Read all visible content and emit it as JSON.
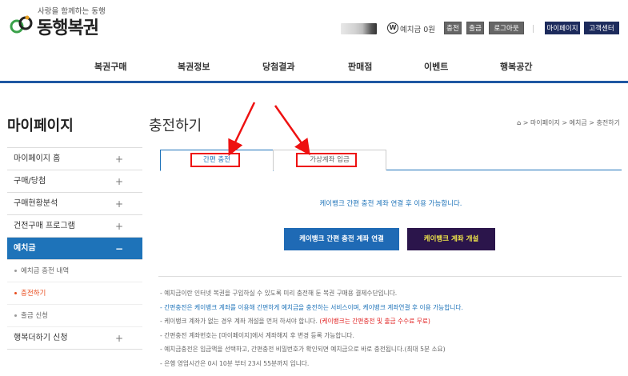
{
  "logo": {
    "tagline": "사랑을 함께하는 동행",
    "name": "동행복권"
  },
  "top_bar": {
    "deposit_icon": "W",
    "deposit_label": "예치금 0원",
    "charge_label": "충전",
    "withdraw_label": "출금",
    "logout_label": "로그아웃",
    "mypage_label": "마이페이지",
    "support_label": "고객센터"
  },
  "gnb": {
    "items": [
      "복권구매",
      "복권정보",
      "당첨결과",
      "판매점",
      "이벤트",
      "행복공간"
    ]
  },
  "sidebar": {
    "title": "마이페이지",
    "items": [
      {
        "label": "마이페이지 홈",
        "toggle": "+"
      },
      {
        "label": "구매/당첨",
        "toggle": "+"
      },
      {
        "label": "구매현황분석",
        "toggle": "+"
      },
      {
        "label": "건전구매 프로그램",
        "toggle": "+"
      },
      {
        "label": "예치금",
        "toggle": "−"
      },
      {
        "label": "행복더하기 신청",
        "toggle": "+"
      }
    ],
    "sub_items": [
      {
        "label": "예치금 충전 내역"
      },
      {
        "label": "충전하기"
      },
      {
        "label": "출금 신청"
      }
    ]
  },
  "content": {
    "title": "충전하기",
    "breadcrumb": [
      "마이페이지",
      "예치금",
      "충전하기"
    ],
    "breadcrumb_sep": ">",
    "tabs": [
      {
        "label": "간편 충전"
      },
      {
        "label": "가상계좌 입금"
      }
    ],
    "notice": "케이뱅크 간편 충전 계좌 연결 후 이용 가능합니다.",
    "buttons": {
      "link_label": "케이뱅크 간편 충전 계좌 연결",
      "open_label": "케이뱅크 계좌 개설"
    },
    "notes": [
      {
        "text": "- 예치금이란 인터넷 복권을 구입하실 수 있도록 미리 충전해 둔 복권 구매용 결제수단입니다."
      },
      {
        "text": "- 간편충전은 케이뱅크 계좌를 이용해 간편하게 예치금을 충전하는 서비스이며, 케이뱅크 계좌연결 후 이용 가능합니다."
      },
      {
        "text": "- 케이뱅크 계좌가 없는 경우 계좌 개설을 먼저 하셔야 합니다. ",
        "highlight": "(케이뱅크는 간편충전 및 출금 수수료 무료)"
      },
      {
        "text": "- 간편충전 계좌번호는 [마이페이지]에서 계좌해지 후 변경 등록 가능합니다."
      },
      {
        "text": "- 예치금충전은 입금액을 선택하고, 간편충전 비밀번호가 확인되면 예치금으로 바로 충전됩니다.(최대 5분 소요)"
      },
      {
        "text": "- 은행 영업시간은 0시 10분 부터 23시 55분까지 입니다."
      }
    ]
  },
  "colors": {
    "brand_blue": "#1e73b9",
    "purple": "#2b154b",
    "annotation_red": "#ee1111"
  }
}
